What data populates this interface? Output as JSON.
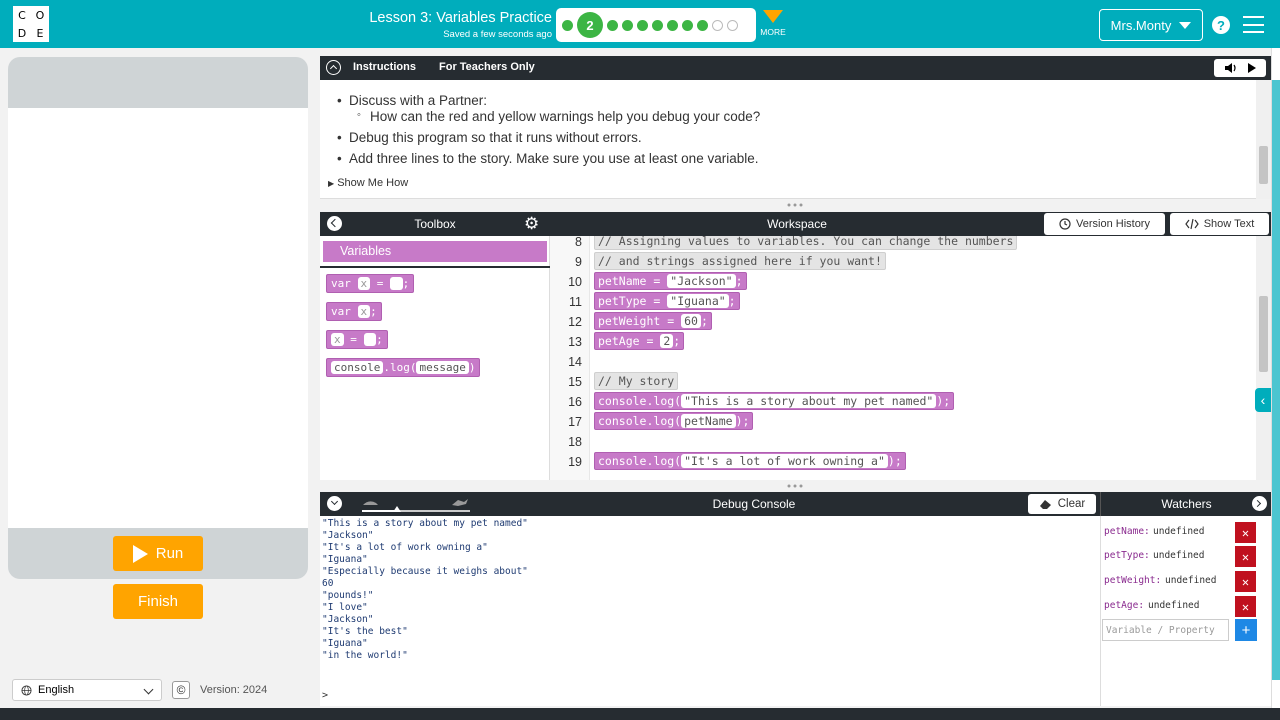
{
  "header": {
    "logo_letters": [
      "C",
      "O",
      "D",
      "E"
    ],
    "lesson_title": "Lesson 3: Variables Practice",
    "saved_status": "Saved a few seconds ago",
    "progress": {
      "current_level": "2",
      "completed_after": 7,
      "remaining": 2
    },
    "more_label": "MORE",
    "user_name": "Mrs.Monty",
    "help_glyph": "?"
  },
  "left": {
    "run_label": "Run",
    "finish_label": "Finish",
    "language": "English",
    "copyright_glyph": "©",
    "version": "Version: 2024"
  },
  "instructions": {
    "tabs": [
      "Instructions",
      "For Teachers Only"
    ],
    "items": [
      {
        "text": "Discuss with a Partner:",
        "sub": "How can the red and yellow warnings help you debug your code?"
      },
      {
        "text": "Debug this program so that it runs without errors."
      },
      {
        "text": "Add three lines to the story. Make sure you use at least one variable."
      }
    ],
    "show_me_how": "Show Me How"
  },
  "toolbox": {
    "title": "Toolbox",
    "category": "Variables",
    "blocks": {
      "var_assign": {
        "kw": "var",
        "name": "x",
        "op": "=",
        "end": ";"
      },
      "var_declare": {
        "kw": "var",
        "name": "x",
        "end": ";"
      },
      "assign": {
        "name": "x",
        "op": "=",
        "end": ";"
      },
      "log": {
        "obj": "console",
        "method": ".log(",
        "arg": "message",
        "end": ")"
      }
    }
  },
  "workspace": {
    "title": "Workspace",
    "version_history": "Version History",
    "show_text": "Show Text",
    "lines": [
      {
        "n": "8",
        "code": "// Assigning values to variables. You can change the numbers"
      },
      {
        "n": "9",
        "code": "// and strings assigned here if you want!"
      },
      {
        "n": "10",
        "name": "petName",
        "op": "=",
        "value": "\"Jackson\"",
        "end": ";"
      },
      {
        "n": "11",
        "name": "petType",
        "op": "=",
        "value": "\"Iguana\"",
        "end": ";"
      },
      {
        "n": "12",
        "name": "petWeight",
        "op": "=",
        "value": "60",
        "end": ";"
      },
      {
        "n": "13",
        "name": "petAge",
        "op": "=",
        "value": "2",
        "end": ";"
      },
      {
        "n": "14"
      },
      {
        "n": "15",
        "code": "// My story"
      },
      {
        "n": "16",
        "obj": "console",
        "method": ".log(",
        "value": "\"This is a story about my pet named\"",
        "end": ");"
      },
      {
        "n": "17",
        "obj": "console",
        "method": ".log(",
        "value": "petName",
        "end": ");"
      },
      {
        "n": "18"
      },
      {
        "n": "19",
        "obj": "console",
        "method": ".log(",
        "value": "\"It's a lot of work owning a\"",
        "end": ");"
      }
    ]
  },
  "debug": {
    "title": "Debug Console",
    "clear_label": "Clear",
    "output": [
      "\"This is a story about my pet named\"",
      "\"Jackson\"",
      "\"It's a lot of work owning a\"",
      "\"Iguana\"",
      "\"Especially because it weighs about\"",
      "60",
      "\"pounds!\"",
      "\"I love\"",
      "\"Jackson\"",
      "\"It's the best\"",
      "\"Iguana\"",
      "\"in the world!\""
    ],
    "prompt": ">"
  },
  "watchers": {
    "title": "Watchers",
    "rows": [
      {
        "name": "petName:",
        "value": "undefined"
      },
      {
        "name": "petType:",
        "value": "undefined"
      },
      {
        "name": "petWeight:",
        "value": "undefined"
      },
      {
        "name": "petAge:",
        "value": "undefined"
      }
    ],
    "input_placeholder": "Variable / Property",
    "delete_glyph": "✕",
    "add_glyph": "+"
  },
  "colors": {
    "header": "#00adbc",
    "block": "#c77ac8",
    "button": "#ffa400",
    "dark": "#262c31",
    "progress": "#3cb544"
  }
}
